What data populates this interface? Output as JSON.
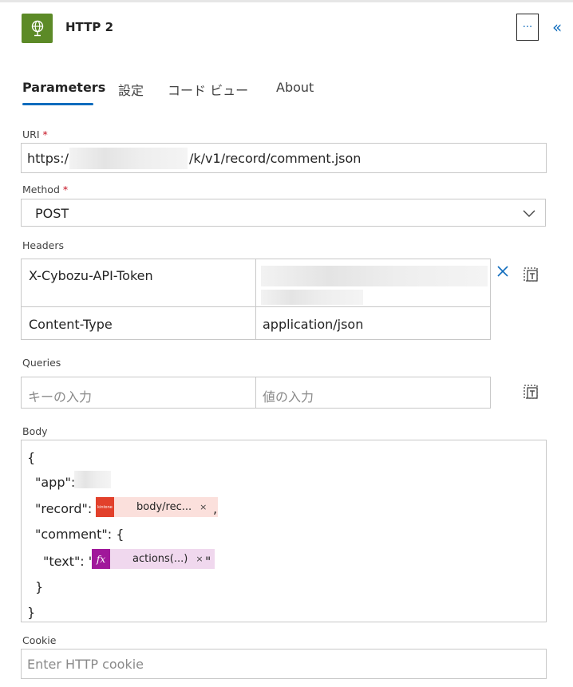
{
  "header": {
    "title": "HTTP 2",
    "more_label": "···",
    "collapse_label": "«"
  },
  "tabs": [
    {
      "label": "Parameters",
      "active": true
    },
    {
      "label": "設定"
    },
    {
      "label": "コード ビュー"
    },
    {
      "label": "About"
    }
  ],
  "uri": {
    "label": "URI",
    "required": "*",
    "value_prefix": "https:/",
    "value_suffix": "/k/v1/record/comment.json"
  },
  "method": {
    "label": "Method",
    "required": "*",
    "value": "POST"
  },
  "headers": {
    "label": "Headers",
    "rows": [
      {
        "key": "X-Cybozu-API-Token",
        "value": ""
      },
      {
        "key": "Content-Type",
        "value": "application/json"
      }
    ]
  },
  "queries": {
    "label": "Queries",
    "key_placeholder": "キーの入力",
    "value_placeholder": "値の入力"
  },
  "body": {
    "label": "Body",
    "lines": {
      "open": "{",
      "app_key": "\"app\":",
      "record_key": "\"record\":",
      "record_token": "body/rec...",
      "record_badge": "kintone",
      "record_after": ",",
      "comment_key": "\"comment\": {",
      "text_key": "\"text\": \"",
      "text_token": "actions(...)",
      "text_badge": "fx",
      "text_after": "\"",
      "inner_close": "}",
      "close": "}"
    },
    "token_remove": "×"
  },
  "cookie": {
    "label": "Cookie",
    "placeholder": "Enter HTTP cookie"
  },
  "colors": {
    "accent": "#0f6cbd",
    "app_icon": "#5c8a27",
    "kintone_badge": "#e2402b",
    "kintone_token_bg": "#fbe0dc",
    "fx_badge": "#a0179a",
    "fx_token_bg": "#f0d8ee",
    "required": "#c50f1f"
  }
}
